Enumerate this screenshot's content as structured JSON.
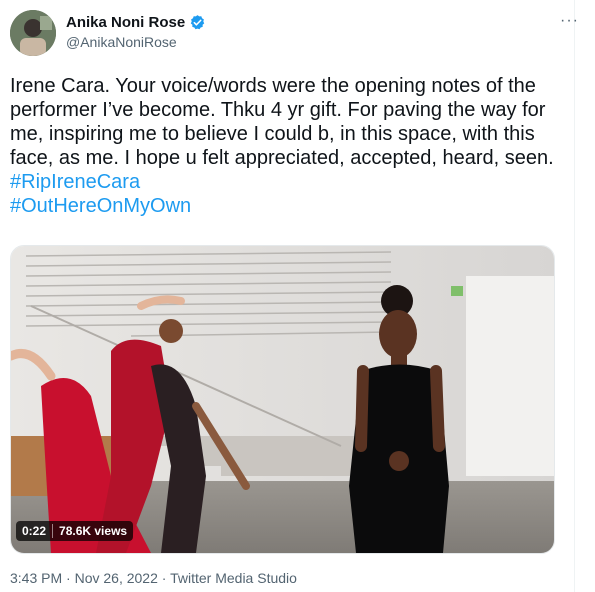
{
  "author": {
    "name": "Anika Noni Rose",
    "handle": "@AnikaNoniRose",
    "verified": true
  },
  "menu": {
    "more_label": "···"
  },
  "tweet": {
    "text": "Irene Cara. Your voice/words were the opening notes of the performer I’ve become. Thku 4 yr gift. For paving the way for me, inspiring me to believe I could b, in this space, with this face, as me. I hope u felt appreciated, accepted, heard, seen. ",
    "hashtags": [
      "#RipIreneCara",
      "#OutHereOnMyOwn"
    ]
  },
  "video": {
    "duration": "0:22",
    "views": "78.6K views"
  },
  "meta": {
    "time": "3:43 PM",
    "date": "Nov 26, 2022",
    "separator": "·",
    "source": "Twitter Media Studio"
  },
  "colors": {
    "accent": "#1d9bf0",
    "text": "#0f1419",
    "muted": "#536471"
  }
}
